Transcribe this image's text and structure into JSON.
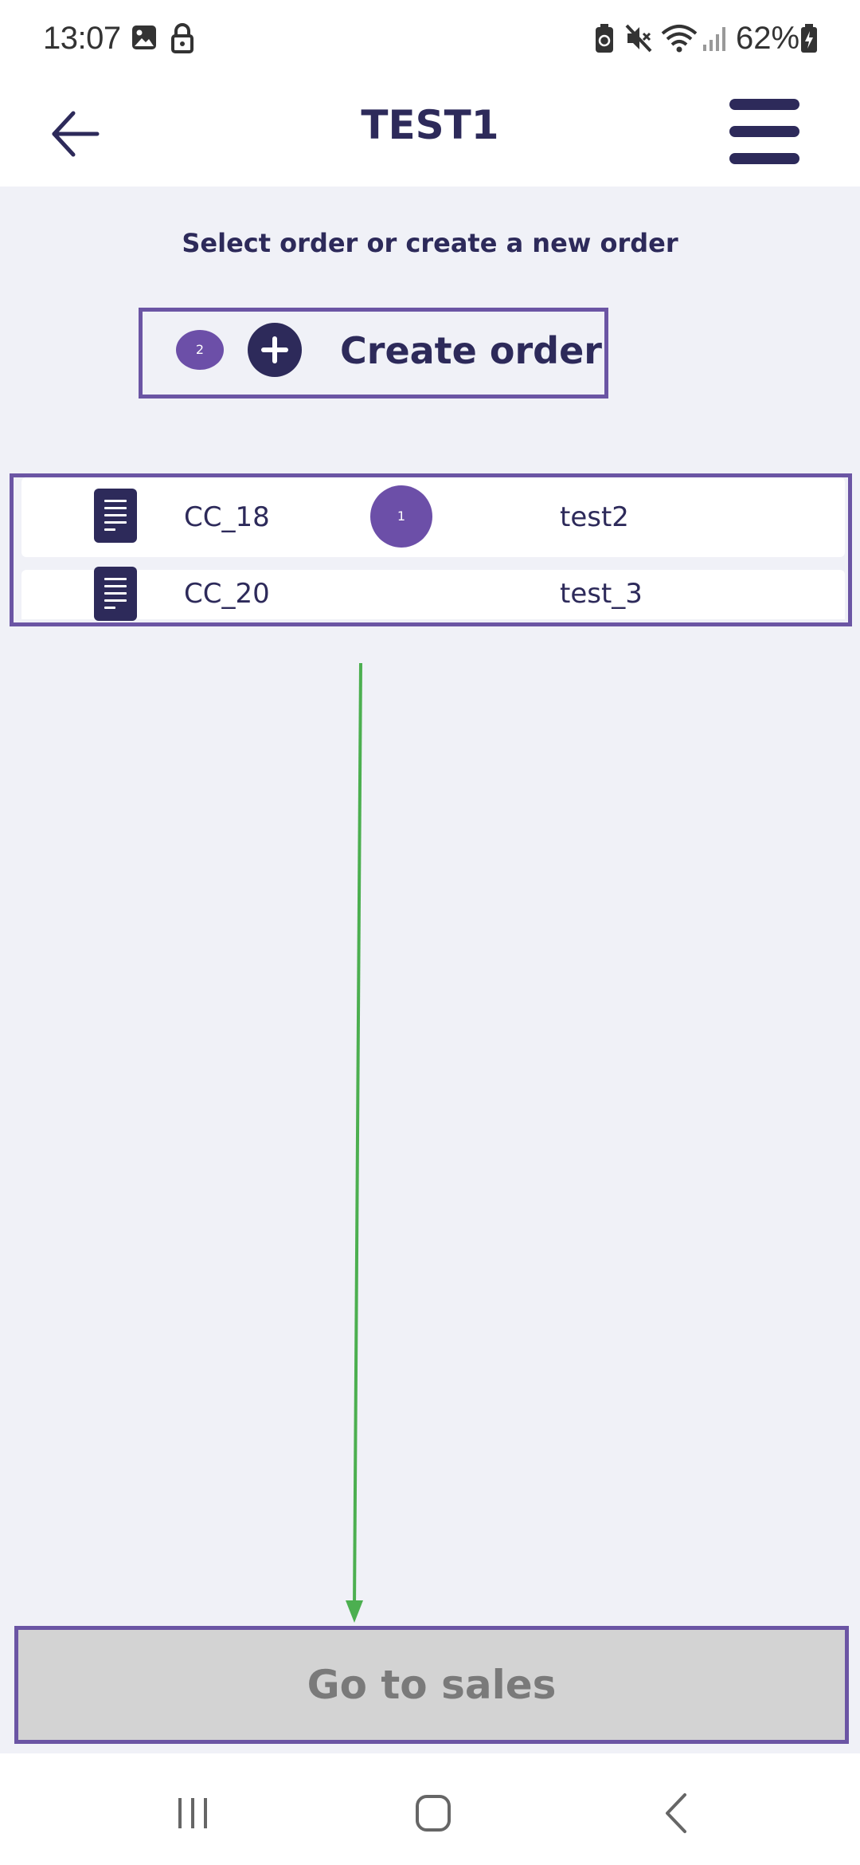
{
  "status_bar": {
    "time": "13:07",
    "battery": "62%",
    "icons": [
      "image-icon",
      "lock-icon",
      "battery-saver-icon",
      "mute-icon",
      "wifi-icon",
      "signal-icon",
      "battery-charging-icon"
    ]
  },
  "header": {
    "title": "TEST1",
    "back_icon": "arrow-left-icon",
    "menu_icon": "hamburger-menu-icon"
  },
  "main": {
    "subtitle": "Select order or create a new order",
    "create_order": {
      "label": "Create order",
      "badge": "2",
      "icon": "plus-circle-icon"
    },
    "orders": [
      {
        "code": "CC_18",
        "name": "test2",
        "icon": "document-icon"
      },
      {
        "code": "CC_20",
        "name": "test_3",
        "icon": "document-icon"
      }
    ],
    "list_badge": "1",
    "go_to_sales_label": "Go to sales"
  },
  "colors": {
    "primary": "#2d2a5a",
    "highlight": "#6b55a4",
    "badge": "#6c4fa8",
    "background": "#f0f1f7",
    "disabled_button": "#d3d3d3",
    "arrow": "#4caf50"
  },
  "nav_bar": {
    "buttons": [
      "recent-apps-icon",
      "home-icon",
      "back-icon"
    ]
  }
}
